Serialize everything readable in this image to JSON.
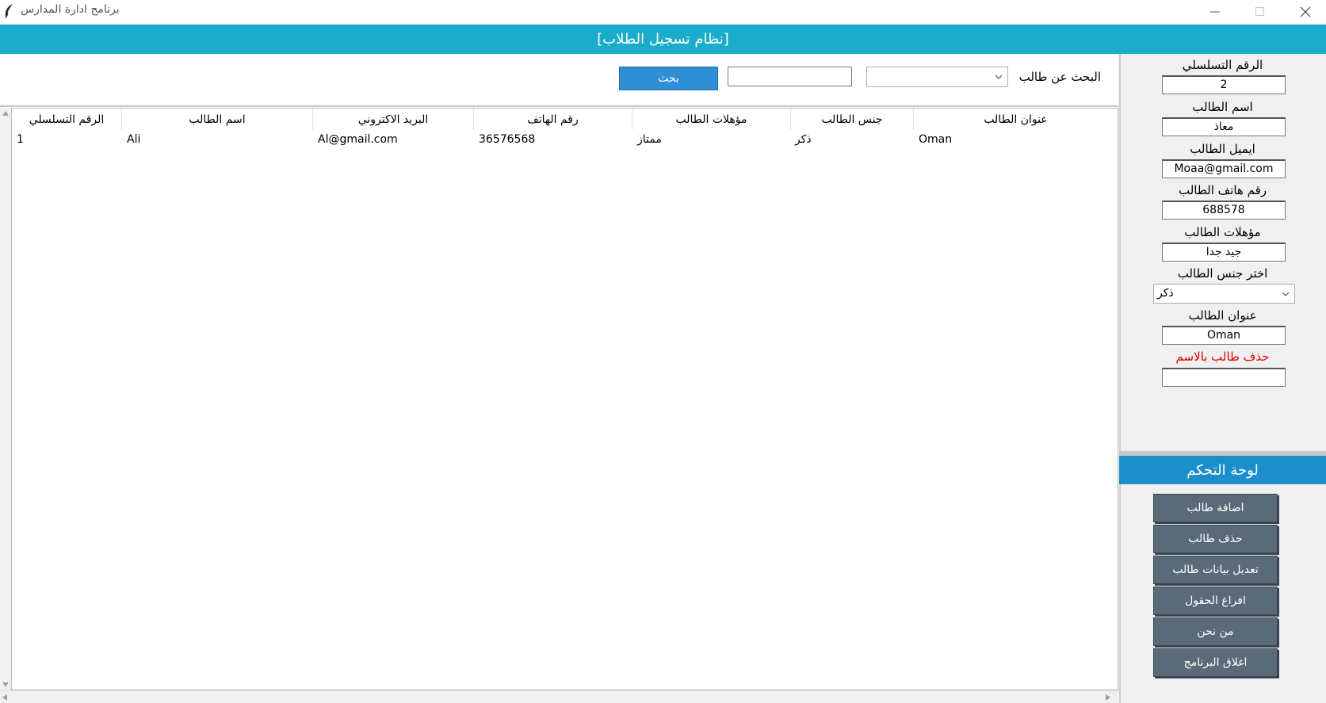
{
  "window": {
    "title": "برنامج ادارة المدارس",
    "icon": "feather-icon"
  },
  "header": {
    "title": "[نظام تسجيل الطلاب]"
  },
  "search": {
    "label": "البحث عن طالب",
    "combo_value": "",
    "input_value": "",
    "button_label": "بحث"
  },
  "table": {
    "columns": [
      "الرقم التسلسلي",
      "اسم الطالب",
      "البريد الاكتروني",
      "رقم الهاتف",
      "مؤهلات الطالب",
      "جنس الطالب",
      "عنوان الطالب"
    ],
    "rows": [
      [
        "1",
        "Ali",
        "Al@gmail.com",
        "36576568",
        "ممتاز",
        "ذكر",
        "Oman"
      ]
    ]
  },
  "form": {
    "serial_label": "الرقم التسلسلي",
    "serial_value": "2",
    "name_label": "اسم الطالب",
    "name_value": "معاذ",
    "email_label": "ايميل الطالب",
    "email_value": "Moaa@gmail.com",
    "phone_label": "رقم هاتف الطالب",
    "phone_value": "688578",
    "qual_label": "مؤهلات الطالب",
    "qual_value": "جيد جدا",
    "gender_label": "اختر جنس الطالب",
    "gender_value": "ذكر",
    "address_label": "عنوان الطالب",
    "address_value": "Oman",
    "delete_label": "حذف طالب بالاسم",
    "delete_value": ""
  },
  "control_panel": {
    "title": "لوحة التحكم",
    "buttons": [
      "اضافة طالب",
      "حذف طالب",
      "تعديل بيانات طالب",
      "افراغ الحقول",
      "من نحن",
      "اغلاق البرنامج"
    ]
  },
  "colors": {
    "header_bg": "#1aadcb",
    "search_button": "#2e8ed6",
    "control_header": "#1c8ecb",
    "control_button": "#5a6a79",
    "delete_label": "#e00000"
  }
}
